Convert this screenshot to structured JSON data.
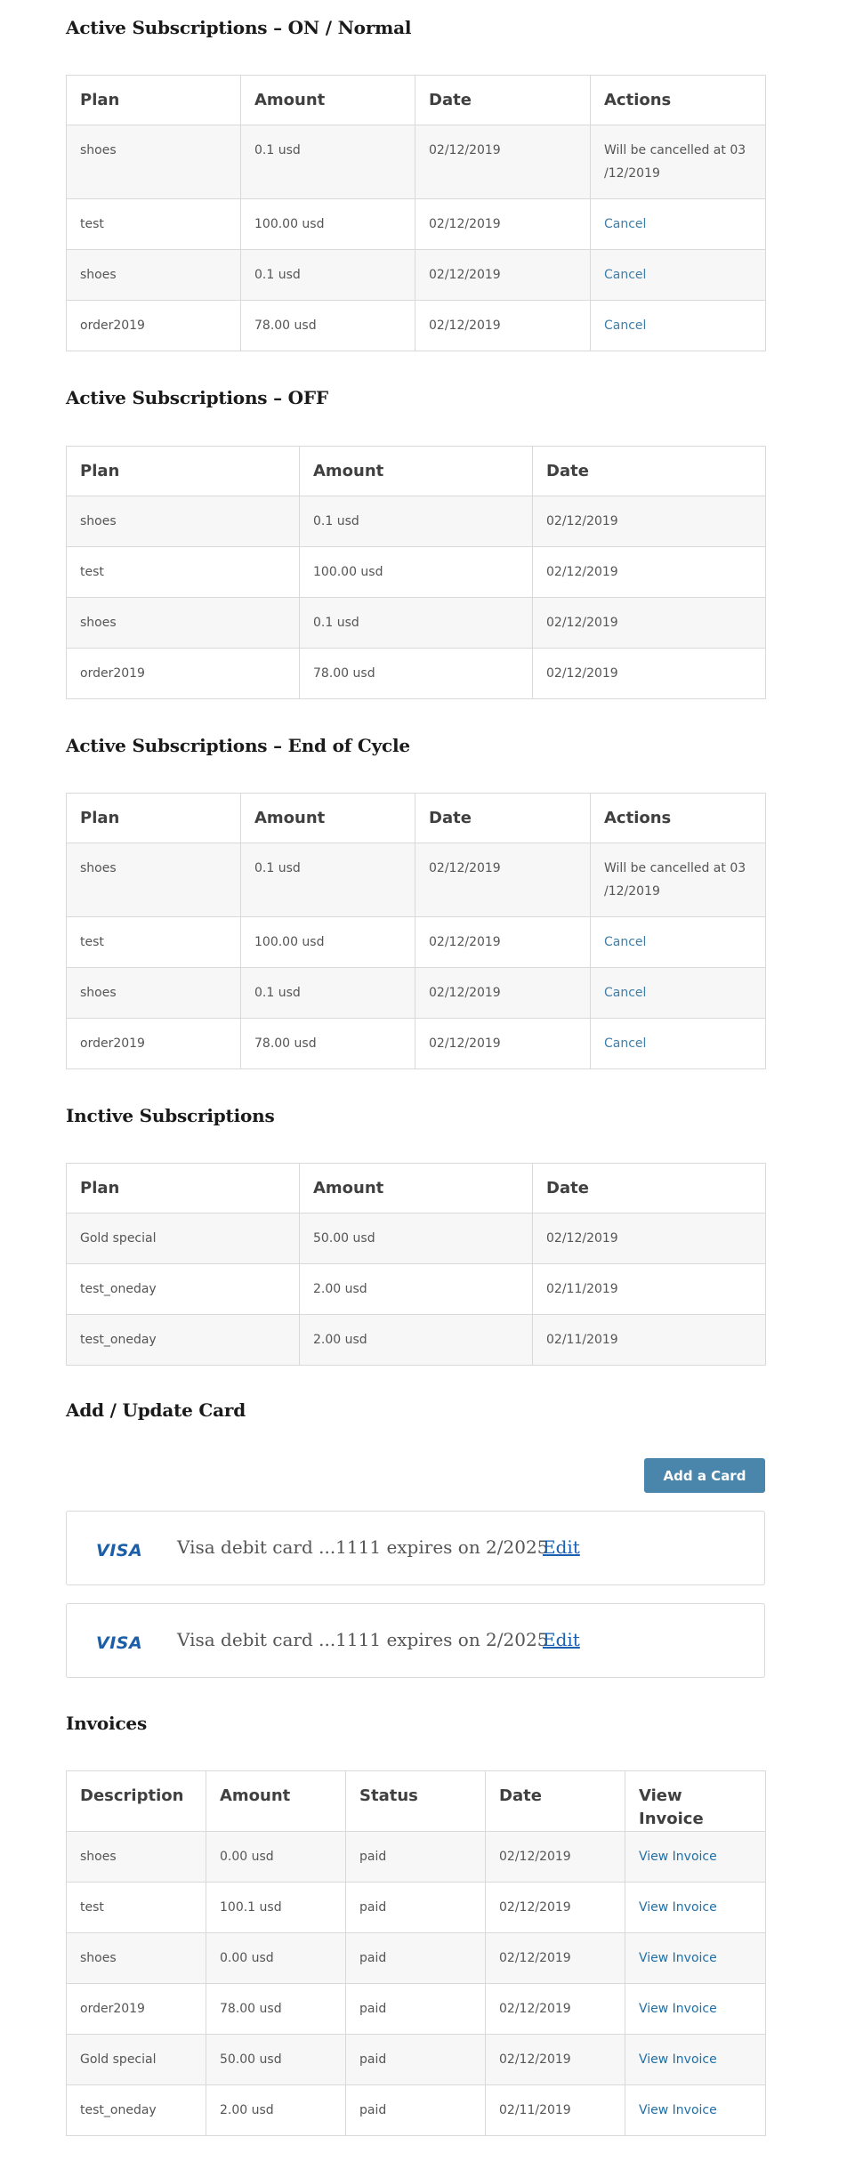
{
  "active_on": {
    "title": "Active Subscriptions – ON / Normal",
    "headers": [
      "Plan",
      "Amount",
      "Date",
      "Actions"
    ],
    "rows": [
      {
        "plan": "shoes",
        "amount": "0.1 usd",
        "date": "02/12/2019",
        "action_text": "Will be cancelled at 03 /12/2019",
        "action_type": "text"
      },
      {
        "plan": "test",
        "amount": "100.00 usd",
        "date": "02/12/2019",
        "action_text": "Cancel",
        "action_type": "link"
      },
      {
        "plan": "shoes",
        "amount": "0.1 usd",
        "date": "02/12/2019",
        "action_text": "Cancel",
        "action_type": "link"
      },
      {
        "plan": "order2019",
        "amount": "78.00 usd",
        "date": "02/12/2019",
        "action_text": "Cancel",
        "action_type": "link"
      }
    ]
  },
  "active_off": {
    "title": "Active Subscriptions – OFF",
    "headers": [
      "Plan",
      "Amount",
      "Date"
    ],
    "rows": [
      {
        "plan": "shoes",
        "amount": "0.1 usd",
        "date": "02/12/2019"
      },
      {
        "plan": "test",
        "amount": "100.00 usd",
        "date": "02/12/2019"
      },
      {
        "plan": "shoes",
        "amount": "0.1 usd",
        "date": "02/12/2019"
      },
      {
        "plan": "order2019",
        "amount": "78.00 usd",
        "date": "02/12/2019"
      }
    ]
  },
  "active_end": {
    "title": "Active Subscriptions – End of Cycle",
    "headers": [
      "Plan",
      "Amount",
      "Date",
      "Actions"
    ],
    "rows": [
      {
        "plan": "shoes",
        "amount": "0.1 usd",
        "date": "02/12/2019",
        "action_text": "Will be cancelled at 03 /12/2019",
        "action_type": "text"
      },
      {
        "plan": "test",
        "amount": "100.00 usd",
        "date": "02/12/2019",
        "action_text": "Cancel",
        "action_type": "link"
      },
      {
        "plan": "shoes",
        "amount": "0.1 usd",
        "date": "02/12/2019",
        "action_text": "Cancel",
        "action_type": "link"
      },
      {
        "plan": "order2019",
        "amount": "78.00 usd",
        "date": "02/12/2019",
        "action_text": "Cancel",
        "action_type": "link"
      }
    ]
  },
  "inactive": {
    "title": "Inctive Subscriptions",
    "headers": [
      "Plan",
      "Amount",
      "Date"
    ],
    "rows": [
      {
        "plan": "Gold special",
        "amount": "50.00 usd",
        "date": "02/12/2019"
      },
      {
        "plan": "test_oneday",
        "amount": "2.00 usd",
        "date": "02/11/2019"
      },
      {
        "plan": "test_oneday",
        "amount": "2.00 usd",
        "date": "02/11/2019"
      }
    ]
  },
  "cards": {
    "title": "Add / Update Card",
    "add_button_label": "Add a Card",
    "items": [
      {
        "brand": "VISA",
        "description": "Visa debit card ...1111 expires on 2/2025",
        "edit_label": "Edit"
      },
      {
        "brand": "VISA",
        "description": "Visa debit card ...1111 expires on 2/2025",
        "edit_label": "Edit"
      }
    ]
  },
  "invoices": {
    "title": "Invoices",
    "headers": [
      "Description",
      "Amount",
      "Status",
      "Date",
      "View Invoice"
    ],
    "rows": [
      {
        "description": "shoes",
        "amount": "0.00 usd",
        "status": "paid",
        "date": "02/12/2019",
        "link": "View Invoice"
      },
      {
        "description": "test",
        "amount": "100.1 usd",
        "status": "paid",
        "date": "02/12/2019",
        "link": "View Invoice"
      },
      {
        "description": "shoes",
        "amount": "0.00 usd",
        "status": "paid",
        "date": "02/12/2019",
        "link": "View Invoice"
      },
      {
        "description": "order2019",
        "amount": "78.00 usd",
        "status": "paid",
        "date": "02/12/2019",
        "link": "View Invoice"
      },
      {
        "description": "Gold special",
        "amount": "50.00 usd",
        "status": "paid",
        "date": "02/12/2019",
        "link": "View Invoice"
      },
      {
        "description": "test_oneday",
        "amount": "2.00 usd",
        "status": "paid",
        "date": "02/11/2019",
        "link": "View Invoice"
      }
    ]
  },
  "colors": {
    "link": "#3f7ea8",
    "button_bg": "#4a86ab",
    "visa_blue": "#1a5fa8",
    "border": "#d9d9d9",
    "stripe": "#f7f7f7"
  }
}
